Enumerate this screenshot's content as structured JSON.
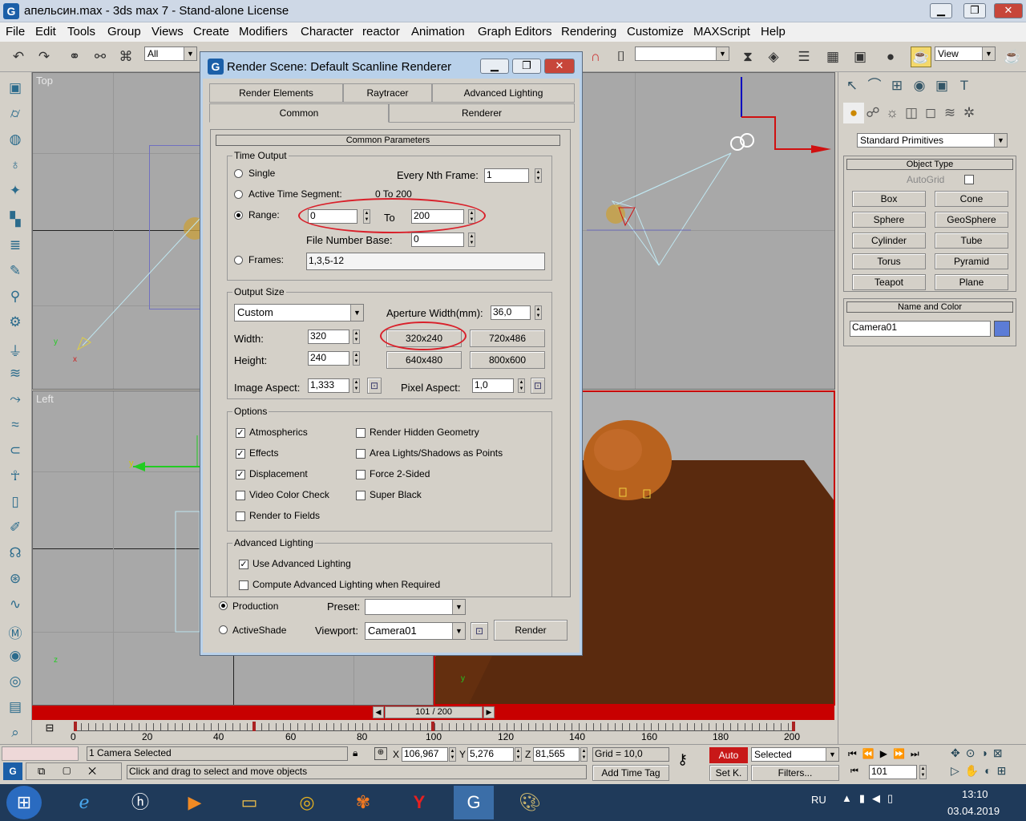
{
  "window": {
    "title": "апельсин.max - 3ds max 7 - Stand-alone License",
    "min": "▁",
    "max": "❐",
    "close": "✕"
  },
  "menu": [
    "File",
    "Edit",
    "Tools",
    "Group",
    "Views",
    "Create",
    "Modifiers",
    "Character",
    "reactor",
    "Animation",
    "Graph Editors",
    "Rendering",
    "Customize",
    "MAXScript",
    "Help"
  ],
  "toolbar": {
    "selection_filter": "All",
    "view_label": "View"
  },
  "viewports": {
    "top": "Top",
    "left": "Left"
  },
  "dialog": {
    "title": "Render Scene: Default Scanline Renderer",
    "tabs_row1": [
      "Render Elements",
      "Raytracer",
      "Advanced Lighting"
    ],
    "tabs_row2": [
      "Common",
      "Renderer"
    ],
    "rollout_title": "Common Parameters",
    "time_output": {
      "title": "Time Output",
      "single": "Single",
      "every_nth_label": "Every Nth Frame:",
      "every_nth_value": "1",
      "active_segment": "Active Time Segment:",
      "active_segment_range": "0 To 200",
      "range_label": "Range:",
      "range_from": "0",
      "range_to_label": "To",
      "range_to": "200",
      "file_number_base_label": "File Number Base:",
      "file_number_base": "0",
      "frames_label": "Frames:",
      "frames_value": "1,3,5-12"
    },
    "output_size": {
      "title": "Output Size",
      "preset": "Custom",
      "aperture_label": "Aperture Width(mm):",
      "aperture_value": "36,0",
      "width_label": "Width:",
      "width_value": "320",
      "height_label": "Height:",
      "height_value": "240",
      "btn1": "320x240",
      "btn2": "720x486",
      "btn3": "640x480",
      "btn4": "800x600",
      "image_aspect_label": "Image Aspect:",
      "image_aspect_value": "1,333",
      "pixel_aspect_label": "Pixel Aspect:",
      "pixel_aspect_value": "1,0"
    },
    "options": {
      "title": "Options",
      "atmospherics": "Atmospherics",
      "effects": "Effects",
      "displacement": "Displacement",
      "video_color_check": "Video Color Check",
      "render_to_fields": "Render to Fields",
      "render_hidden": "Render Hidden Geometry",
      "area_lights": "Area Lights/Shadows as Points",
      "force_2sided": "Force 2-Sided",
      "super_black": "Super Black"
    },
    "advanced_lighting": {
      "title": "Advanced Lighting",
      "use": "Use Advanced Lighting",
      "compute": "Compute Advanced Lighting when Required"
    },
    "bottom": {
      "production": "Production",
      "activeshade": "ActiveShade",
      "preset_label": "Preset:",
      "preset_value": "",
      "viewport_label": "Viewport:",
      "viewport_value": "Camera01",
      "render": "Render"
    }
  },
  "command_panel": {
    "category": "Standard Primitives",
    "object_type_title": "Object Type",
    "autogrid": "AutoGrid",
    "buttons": [
      "Box",
      "Cone",
      "Sphere",
      "GeoSphere",
      "Cylinder",
      "Tube",
      "Torus",
      "Pyramid",
      "Teapot",
      "Plane"
    ],
    "name_color_title": "Name and Color",
    "name_value": "Camera01",
    "color": "#5c7cd6"
  },
  "timeline": {
    "frame_display": "101 / 200",
    "ticks": [
      "0",
      "20",
      "40",
      "60",
      "80",
      "100",
      "120",
      "140",
      "160",
      "180",
      "200"
    ]
  },
  "status": {
    "selected": "1 Camera Selected",
    "prompt": "Click and drag to select and move objects",
    "x_label": "X",
    "x": "106,967",
    "y_label": "Y",
    "y": "5,276",
    "z_label": "Z",
    "z": "81,565",
    "grid": "Grid = 10,0",
    "add_time_tag": "Add Time Tag",
    "auto": "Auto",
    "set_key": "Set K.",
    "selected_combo": "Selected",
    "filters": "Filters...",
    "frame_field": "101"
  },
  "taskbar": {
    "lang": "RU",
    "time": "13:10",
    "date": "03.04.2019"
  }
}
